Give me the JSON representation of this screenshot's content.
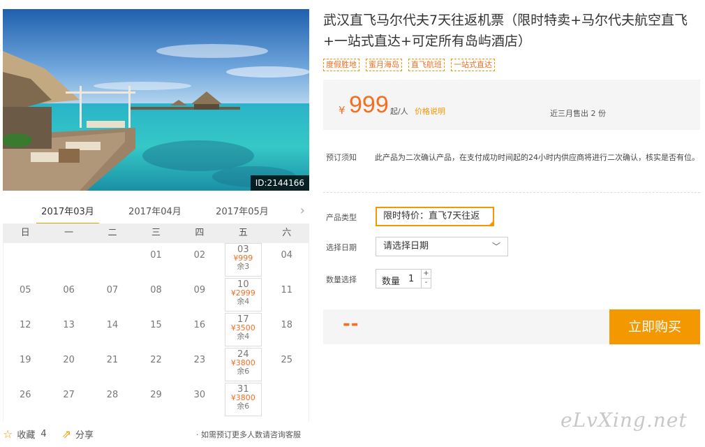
{
  "hero": {
    "image_id": "ID:2144166"
  },
  "months": {
    "tabs": [
      "2017年03月",
      "2017年04月",
      "2017年05月"
    ],
    "active": 0,
    "next_icon": "chevron-right-icon"
  },
  "calendar": {
    "weekdays": [
      "日",
      "一",
      "二",
      "三",
      "四",
      "五",
      "六"
    ],
    "weeks": [
      [
        {
          "d": ""
        },
        {
          "d": ""
        },
        {
          "d": ""
        },
        {
          "d": "01"
        },
        {
          "d": "02"
        },
        {
          "d": "03",
          "price": "¥999",
          "rest": "余3"
        },
        {
          "d": "04"
        }
      ],
      [
        {
          "d": "05"
        },
        {
          "d": "06"
        },
        {
          "d": "07"
        },
        {
          "d": "08"
        },
        {
          "d": "09"
        },
        {
          "d": "10",
          "price": "¥2999",
          "rest": "余4"
        },
        {
          "d": "11"
        }
      ],
      [
        {
          "d": "12"
        },
        {
          "d": "13"
        },
        {
          "d": "14"
        },
        {
          "d": "15"
        },
        {
          "d": "16"
        },
        {
          "d": "17",
          "price": "¥3500",
          "rest": "余4"
        },
        {
          "d": "18"
        }
      ],
      [
        {
          "d": "19"
        },
        {
          "d": "20"
        },
        {
          "d": "21"
        },
        {
          "d": "22"
        },
        {
          "d": "23"
        },
        {
          "d": "24",
          "price": "¥3800",
          "rest": "余6"
        },
        {
          "d": "25"
        }
      ],
      [
        {
          "d": "26"
        },
        {
          "d": "27"
        },
        {
          "d": "28"
        },
        {
          "d": "29"
        },
        {
          "d": "30"
        },
        {
          "d": "31",
          "price": "¥3800",
          "rest": "余6"
        },
        {
          "d": ""
        }
      ]
    ]
  },
  "bottom": {
    "favorite_label": "收藏",
    "favorite_count": "4",
    "share_label": "分享",
    "consult_text": "· 如需预订更多人数请咨询客服"
  },
  "product": {
    "title": "武汉直飞马尔代夫7天往返机票（限时特卖+马尔代夫航空直飞+一站式直达+可定所有岛屿酒店）",
    "tags": [
      "度假胜地",
      "蜜月海岛",
      "直飞航班",
      "一站式直达"
    ]
  },
  "price": {
    "currency": "¥",
    "amount": "999",
    "unit": "起/人",
    "note_link": "价格说明",
    "sold": "近三月售出 2 份"
  },
  "notice": {
    "label": "预订须知",
    "text": "此产品为二次确认产品，在支付成功时间起的24小时内供应商将进行二次确认，核实是否有位。"
  },
  "form": {
    "type_label": "产品类型",
    "type_value": "限时特价：直飞7天往返",
    "date_label": "选择日期",
    "date_placeholder": "请选择日期",
    "qty_label": "数量选择",
    "qty_text": "数量",
    "qty_value": "1",
    "plus": "+",
    "minus": "-"
  },
  "buy": {
    "total": "--",
    "button": "立即购买"
  },
  "watermark": "eLvXing.net",
  "colors": {
    "accent": "#f39800",
    "price": "#f36f21",
    "panel_bg": "#f5f5f5"
  }
}
